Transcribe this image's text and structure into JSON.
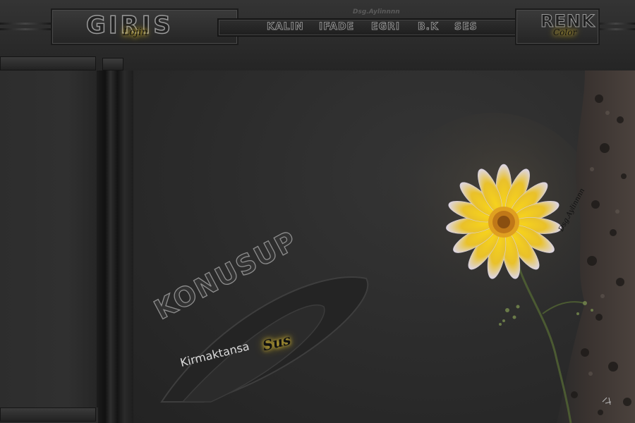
{
  "header": {
    "login": {
      "title": "GIRIS",
      "subtitle": "Lojin"
    },
    "designer": "Dsg.Aylinnnn",
    "nav": [
      "KALIN",
      "IFADE",
      "EGRI",
      "B.K",
      "SES"
    ],
    "color": {
      "title": "RENK",
      "subtitle": "Color"
    }
  },
  "slogan": {
    "main": "KONUSUP",
    "sub": "Kirmaktansa",
    "accent": "Sus"
  },
  "photo": {
    "signature": "Dsg.Aylinnnn"
  },
  "colors": {
    "background": "#2a2a2a",
    "glow": "#f0d040",
    "petal": "#f2c51a"
  }
}
